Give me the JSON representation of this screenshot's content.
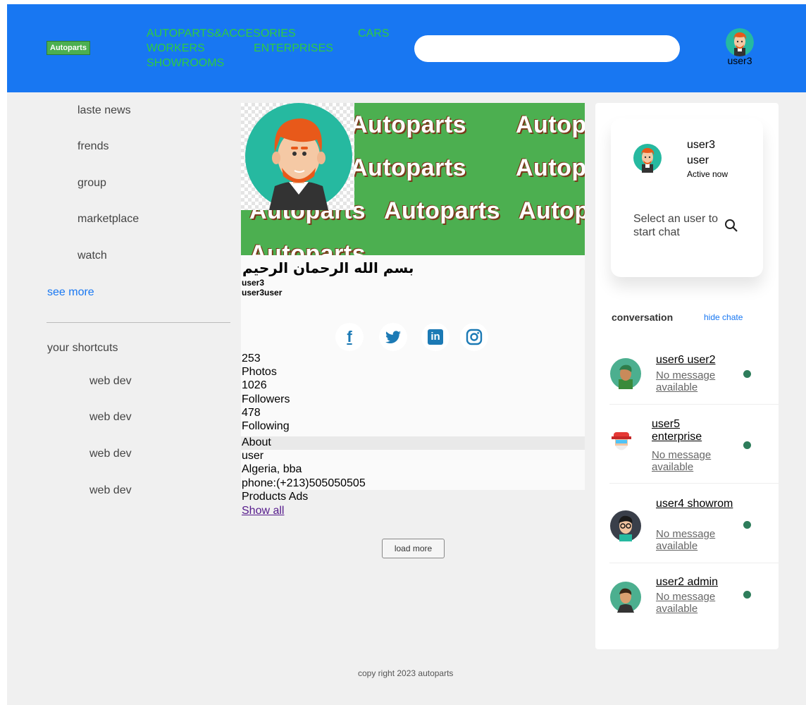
{
  "header": {
    "logo": "Autoparts",
    "nav": [
      "AUTOPARTS&ACCESORIES",
      "CARS",
      "WORKERS",
      "ENTERPRISES",
      "SHOWROOMS"
    ],
    "search": {
      "value": "",
      "placeholder": ""
    },
    "user": "user3"
  },
  "sidebar": {
    "items": [
      "laste news",
      "frends",
      "group",
      "marketplace",
      "watch"
    ],
    "see_more": "see more",
    "shortcuts_title": "your shortcuts",
    "shortcuts": [
      "web dev",
      "web dev",
      "web dev",
      "web dev"
    ]
  },
  "profile": {
    "cover_watermark": "Autoparts",
    "bismillah": "بسم الله الرحمان الرحيم",
    "username": "user3",
    "fullname": "user3user",
    "social": {
      "facebook": "f",
      "twitter": "twitter-icon",
      "linkedin": "in",
      "instagram": "instagram-icon"
    },
    "stats": [
      {
        "value": "253",
        "label": "Photos"
      },
      {
        "value": "1026",
        "label": "Followers"
      },
      {
        "value": "478",
        "label": "Following"
      }
    ],
    "about_title": "About",
    "about": [
      "user",
      "Algeria, bba",
      "phone:(+213)505050505"
    ],
    "products_title": "Products Ads",
    "show_all": "Show all",
    "load_more": "load more"
  },
  "chat": {
    "me": {
      "name": "user3",
      "role": "user",
      "status": "Active now"
    },
    "prompt": "Select an user to start chat",
    "conversation_title": "conversation",
    "hide_chat": "hide chate",
    "list": [
      {
        "name": "user6 user2",
        "message": "No message available",
        "status_color": "#2e7d5b"
      },
      {
        "name": "user5 enterprise",
        "message": "No message available",
        "status_color": "#2e7d5b"
      },
      {
        "name": "user4 showrom",
        "message": "No message available",
        "status_color": "#2e7d5b"
      },
      {
        "name": "user2 admin",
        "message": "No message available",
        "status_color": "#2e7d5b"
      }
    ]
  },
  "footer": {
    "copyright": "copy right 2023 autoparts"
  },
  "colors": {
    "header_bg": "#1877f2",
    "nav_link": "#2ecc40",
    "cover_bg": "#4caf50",
    "status_dot": "#2e7d5b"
  }
}
